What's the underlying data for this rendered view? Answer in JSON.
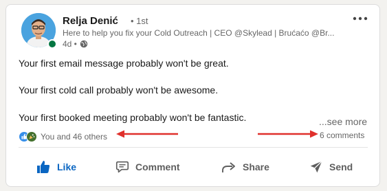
{
  "post": {
    "author": {
      "name": "Relja Denić",
      "degree": "• 1st",
      "headline": "Here to help you fix your Cold Outreach | CEO @Skylead | Brućaćo @Br...",
      "time": "4d •"
    },
    "lines": [
      "Your first email message probably won't be great.",
      "Your first cold call probably won't be awesome.",
      "Your first booked meeting probably won't be fantastic."
    ],
    "see_more": "...see more",
    "reactions_text": "You and 46 others",
    "comments_text": "6 comments"
  },
  "actions": {
    "like": "Like",
    "comment": "Comment",
    "share": "Share",
    "send": "Send"
  },
  "colors": {
    "accent": "#0a66c2",
    "annotation_arrow": "#e0302b",
    "presence": "#057642"
  },
  "icons": [
    "globe-icon",
    "more-options-icon",
    "like-reaction-icon",
    "celebrate-reaction-icon",
    "thumbs-up-icon",
    "comment-icon",
    "share-icon",
    "send-icon"
  ]
}
